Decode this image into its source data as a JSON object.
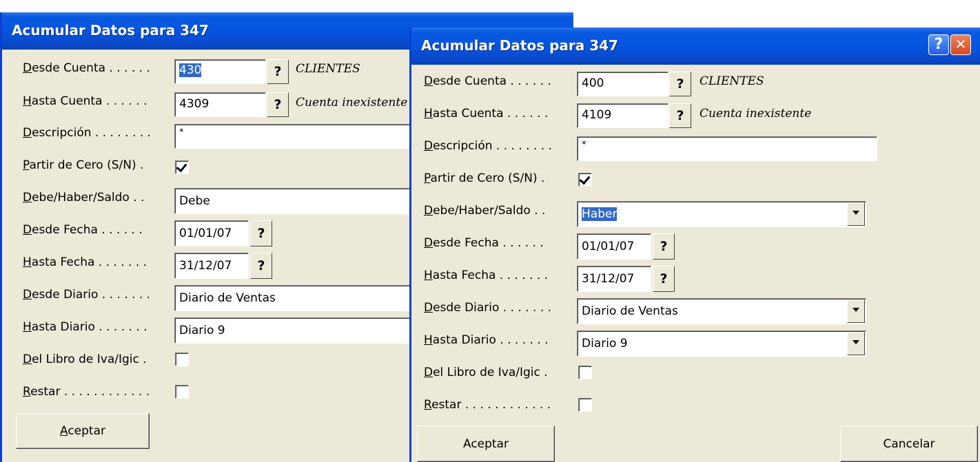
{
  "back_dialog": {
    "title": "Acumular Datos para 347",
    "labels": {
      "desde_cuenta": [
        "D",
        "esde Cuenta . . . . . ."
      ],
      "hasta_cuenta": [
        "H",
        "asta Cuenta . . . . . ."
      ],
      "descripcion": [
        "D",
        "escripción . . . . . . . ."
      ],
      "partir_cero": [
        "P",
        "artir de Cero (S/N) ."
      ],
      "debe_haber": [
        "D",
        "ebe/Haber/Saldo . ."
      ],
      "desde_fecha": [
        "D",
        "esde Fecha . . . . . ."
      ],
      "hasta_fecha": [
        "H",
        "asta Fecha . . . . . . ."
      ],
      "desde_diario": [
        "D",
        "esde Diario . . . . . . ."
      ],
      "hasta_diario": [
        "H",
        "asta Diario . . . . . . ."
      ],
      "libro_iva": [
        "D",
        "el Libro de Iva/Igic ."
      ],
      "restar": [
        "R",
        "estar . . . . . . . . . . . ."
      ]
    },
    "values": {
      "desde_cuenta": "430",
      "hasta_cuenta": "4309",
      "descripcion": "*",
      "debe_haber": "Debe",
      "desde_fecha": "01/01/07",
      "hasta_fecha": "31/12/07",
      "desde_diario": "Diario de Ventas",
      "hasta_diario": "Diario 9"
    },
    "desc_desde": "CLIENTES",
    "desc_hasta": "Cuenta inexistente",
    "partir_cero_checked": true,
    "libro_iva_checked": false,
    "restar_checked": false,
    "aceptar": [
      "A",
      "ceptar"
    ]
  },
  "front_dialog": {
    "title": "Acumular Datos para 347",
    "help_glyph": "?",
    "close_glyph": "✕",
    "labels": {
      "desde_cuenta": [
        "D",
        "esde Cuenta . . . . . ."
      ],
      "hasta_cuenta": [
        "H",
        "asta Cuenta . . . . . ."
      ],
      "descripcion": [
        "D",
        "escripción . . . . . . . ."
      ],
      "partir_cero": [
        "P",
        "artir de Cero (S/N) ."
      ],
      "debe_haber": [
        "D",
        "ebe/Haber/Saldo . ."
      ],
      "desde_fecha": [
        "D",
        "esde Fecha . . . . . ."
      ],
      "hasta_fecha": [
        "H",
        "asta Fecha . . . . . . ."
      ],
      "desde_diario": [
        "D",
        "esde Diario . . . . . . ."
      ],
      "hasta_diario": [
        "H",
        "asta Diario . . . . . . ."
      ],
      "libro_iva": [
        "D",
        "el Libro de Iva/Igic ."
      ],
      "restar": [
        "R",
        "estar . . . . . . . . . . . ."
      ]
    },
    "values": {
      "desde_cuenta": "400",
      "hasta_cuenta": "4109",
      "descripcion": "*",
      "debe_haber": "Haber",
      "desde_fecha": "01/01/07",
      "hasta_fecha": "31/12/07",
      "desde_diario": "Diario de Ventas",
      "hasta_diario": "Diario 9"
    },
    "desc_desde": "CLIENTES",
    "desc_hasta": "Cuenta inexistente",
    "partir_cero_checked": true,
    "libro_iva_checked": false,
    "restar_checked": false,
    "aceptar": [
      "A",
      "ceptar"
    ],
    "cancelar": [
      "C",
      "ancelar"
    ]
  },
  "lookup_glyph": "?",
  "colors": {
    "titlebar": "#0554e0",
    "dialog_bg": "#ece9d8",
    "selection": "#316ac5"
  }
}
